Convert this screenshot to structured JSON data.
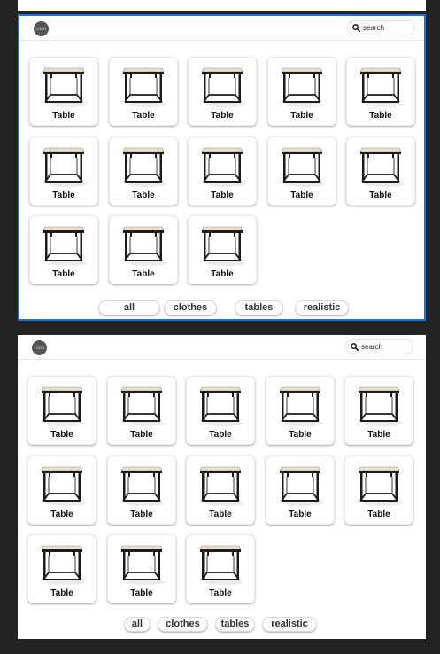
{
  "logo": {
    "text": "LOGO"
  },
  "search": {
    "placeholder": "search"
  },
  "product_label": "Table",
  "filters": [
    {
      "label": "all"
    },
    {
      "label": "clothes"
    },
    {
      "label": "tables"
    },
    {
      "label": "realistic"
    }
  ],
  "colors": {
    "frame_selected": "#1a73d9",
    "canvas": "#232323",
    "tabletop": "#e8dfcf",
    "frame_metal": "#1c1c1c"
  }
}
